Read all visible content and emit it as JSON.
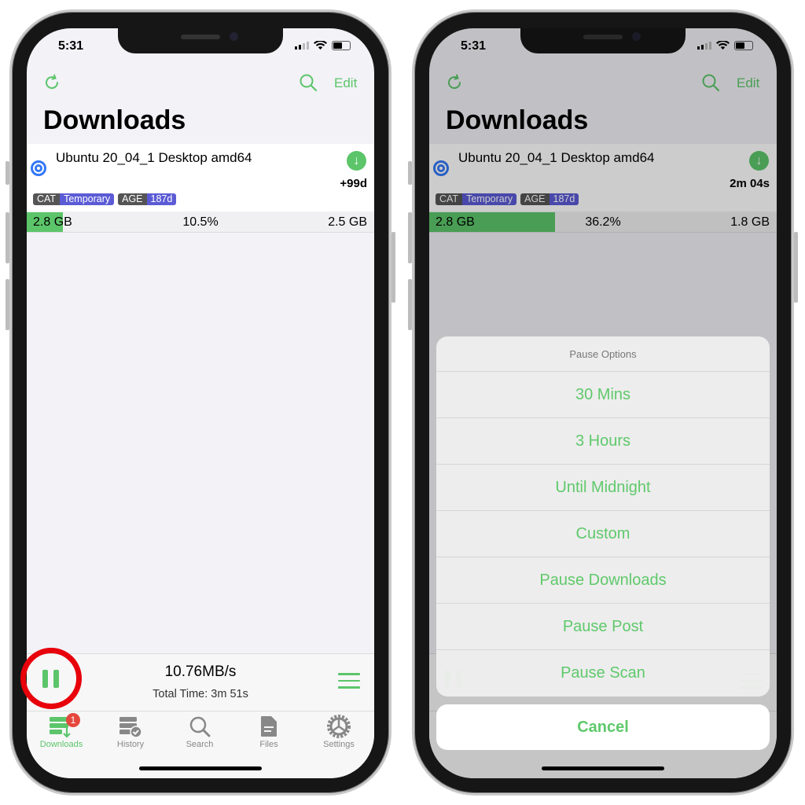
{
  "colors": {
    "accent": "#5cc56a",
    "tag_dark": "#555555",
    "tag_purple": "#5b5bd6",
    "highlight": "#e8000b"
  },
  "left": {
    "status_time": "5:31",
    "edit_label": "Edit",
    "title": "Downloads",
    "item": {
      "name": "Ubuntu 20_04_1 Desktop amd64",
      "eta": "+99d",
      "tags": [
        {
          "k": "CAT",
          "v": "Temporary"
        },
        {
          "k": "AGE",
          "v": "187d"
        }
      ],
      "downloaded": "2.8 GB",
      "percent": "10.5%",
      "progress": 10.5,
      "remaining": "2.5 GB"
    },
    "speed": "10.76MB/s",
    "total_time": "Total Time: 3m 51s",
    "tabs": [
      {
        "label": "Downloads",
        "badge": "1"
      },
      {
        "label": "History"
      },
      {
        "label": "Search"
      },
      {
        "label": "Files"
      },
      {
        "label": "Settings"
      }
    ]
  },
  "right": {
    "status_time": "5:31",
    "edit_label": "Edit",
    "title": "Downloads",
    "item": {
      "name": "Ubuntu 20_04_1 Desktop amd64",
      "eta": "2m 04s",
      "tags": [
        {
          "k": "CAT",
          "v": "Temporary"
        },
        {
          "k": "AGE",
          "v": "187d"
        }
      ],
      "downloaded": "2.8 GB",
      "percent": "36.2%",
      "progress": 36.2,
      "remaining": "1.8 GB"
    },
    "sheet": {
      "title": "Pause Options",
      "options": [
        "30 Mins",
        "3 Hours",
        "Until Midnight",
        "Custom",
        "Pause Downloads",
        "Pause Post",
        "Pause Scan"
      ],
      "cancel": "Cancel"
    }
  }
}
